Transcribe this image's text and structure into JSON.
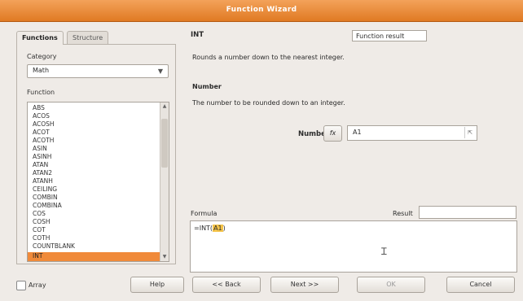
{
  "window": {
    "title": "Function Wizard"
  },
  "tabs": [
    {
      "label": "Functions"
    },
    {
      "label": "Structure"
    }
  ],
  "left": {
    "category_label": "Category",
    "category_value": "Math",
    "function_label": "Function",
    "functions": [
      "ABS",
      "ACOS",
      "ACOSH",
      "ACOT",
      "ACOTH",
      "ASIN",
      "ASINH",
      "ATAN",
      "ATAN2",
      "ATANH",
      "CEILING",
      "COMBIN",
      "COMBINA",
      "COS",
      "COSH",
      "COT",
      "COTH",
      "COUNTBLANK",
      "INT"
    ],
    "selected_function": "INT"
  },
  "right": {
    "function_name": "INT",
    "function_result_label": "Function result",
    "description": "Rounds a number down to the nearest integer.",
    "argument_name": "Number",
    "argument_description": "The number to be rounded down to an integer.",
    "number_label": "Number",
    "fx_label": "fx",
    "number_value": "A1",
    "shrink_icon": "shrink-icon",
    "formula_label": "Formula",
    "result_label": "Result",
    "formula_prefix": "=INT(",
    "formula_highlight": "A1",
    "formula_suffix": ")"
  },
  "footer": {
    "array_label": "Array",
    "help_label": "Help",
    "back_label": "<< Back",
    "next_label": "Next >>",
    "ok_label": "OK",
    "cancel_label": "Cancel"
  },
  "colors": {
    "titlebar": "#e07a23",
    "selection": "#f08a3a",
    "highlight": "#f5c44a"
  }
}
